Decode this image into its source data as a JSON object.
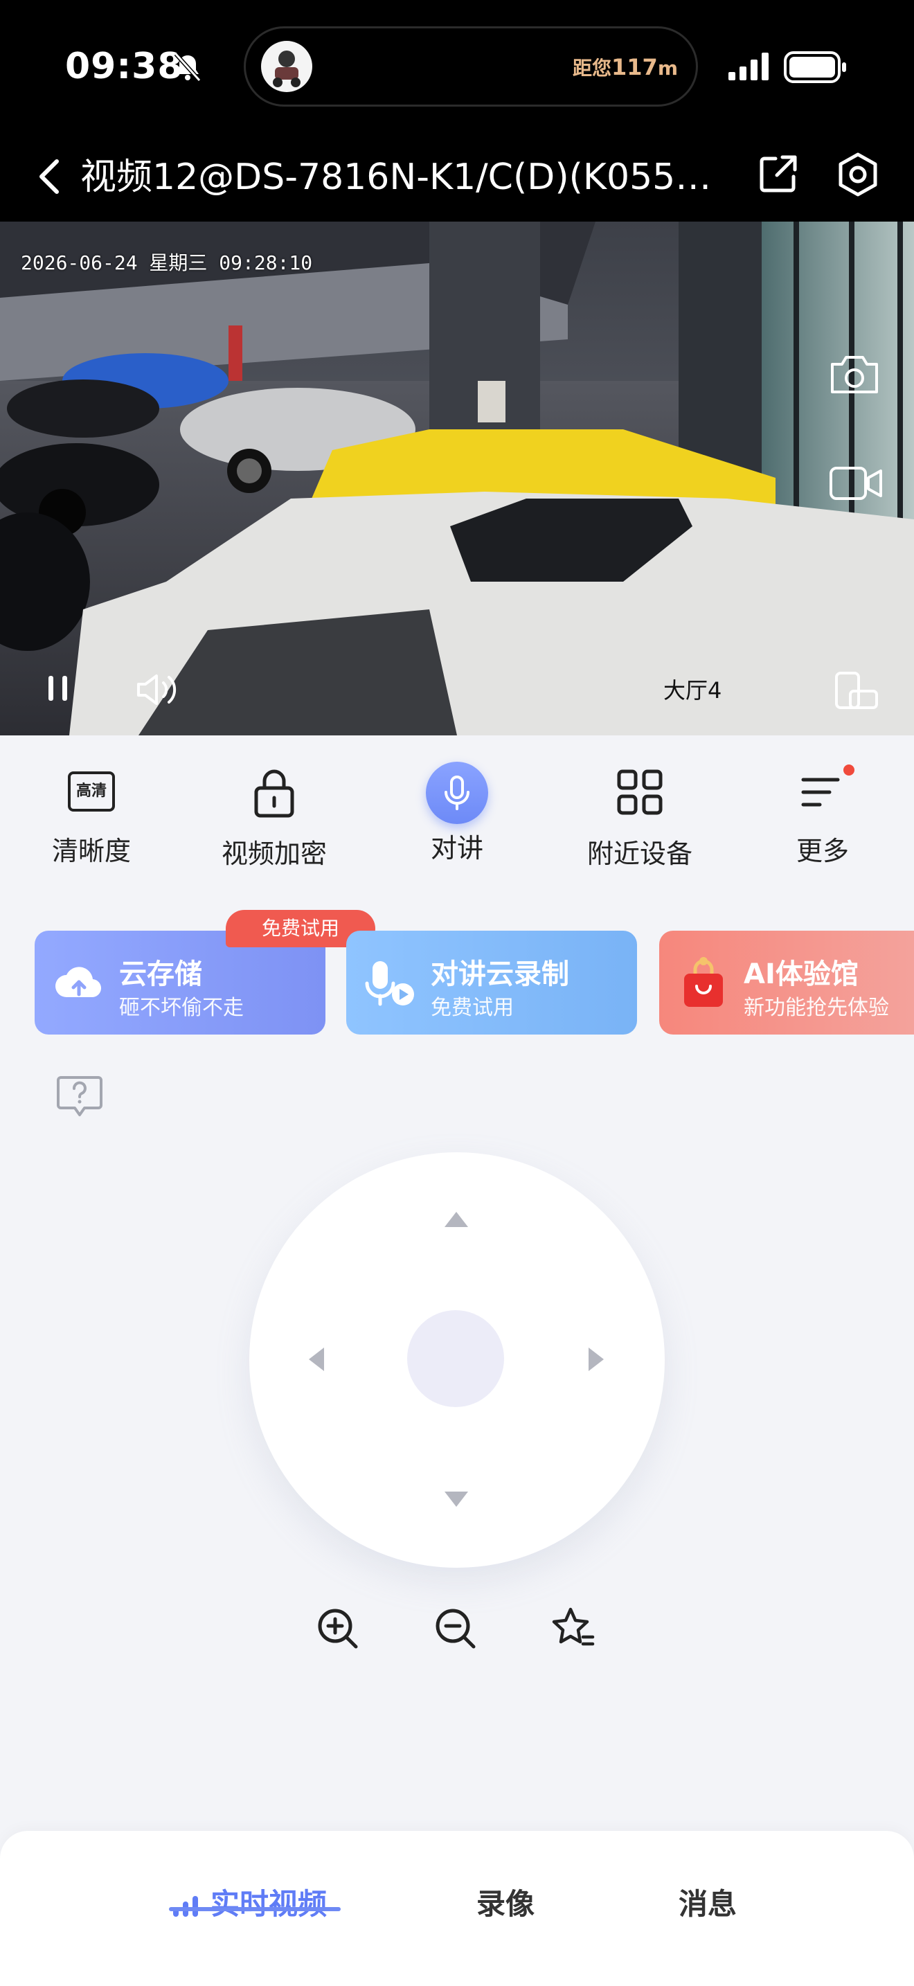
{
  "status_bar": {
    "time": "09:38",
    "distance_prefix": "距您",
    "distance_value": "117",
    "distance_unit": "m"
  },
  "header": {
    "title": "视频12@DS-7816N-K1/C(D)(K0557…"
  },
  "video": {
    "osd_timestamp": "2026-06-24 星期三 09:28:10",
    "channel_label": "大厅4"
  },
  "toolbar": {
    "clarity_badge": "高清",
    "items": [
      {
        "label": "清晰度"
      },
      {
        "label": "视频加密"
      },
      {
        "label": "对讲"
      },
      {
        "label": "附近设备"
      },
      {
        "label": "更多"
      }
    ]
  },
  "promos": [
    {
      "title": "云存储",
      "subtitle": "砸不坏偷不走",
      "badge": "免费试用"
    },
    {
      "title": "对讲云录制",
      "subtitle": "免费试用"
    },
    {
      "title": "AI体验馆",
      "subtitle": "新功能抢先体验"
    }
  ],
  "bottom_tabs": [
    {
      "label": "实时视频"
    },
    {
      "label": "录像"
    },
    {
      "label": "消息"
    }
  ],
  "colors": {
    "accent": "#5f7cf6",
    "badge_red": "#f05a50",
    "background": "#f3f4f8"
  },
  "icons": [
    "bell-slash-icon",
    "signal-icon",
    "battery-icon",
    "back-icon",
    "share-icon",
    "settings-icon",
    "snapshot-icon",
    "record-icon",
    "pause-icon",
    "volume-icon",
    "rotate-screen-icon",
    "hd-icon",
    "lock-icon",
    "microphone-icon",
    "grid-icon",
    "menu-icon",
    "cloud-upload-icon",
    "mic-video-icon",
    "gift-bag-icon",
    "help-bubble-icon",
    "zoom-in-icon",
    "zoom-out-icon",
    "favorite-star-icon"
  ]
}
